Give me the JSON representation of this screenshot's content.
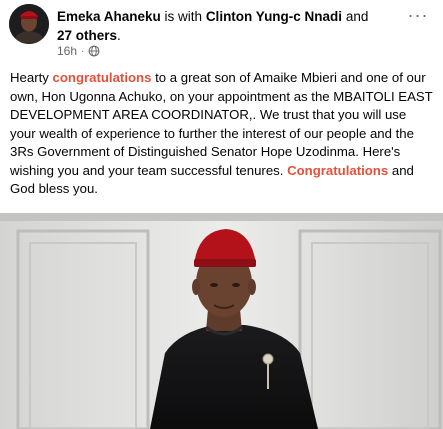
{
  "author": {
    "name": "Emeka Ahaneku",
    "with_text": " is with ",
    "tagged": "Clinton Yung-c Nnadi",
    "and_text": " and ",
    "others": "27 others",
    "period": "."
  },
  "meta": {
    "time": "16h",
    "separator": "·",
    "privacy_icon": "globe-icon"
  },
  "menu": {
    "label": "···"
  },
  "post": {
    "p1": "Hearty ",
    "h1": "congratulations",
    "p2": " to a great son of Amaike Mbieri  and one of our own, Hon Ugonna Achuko, on your appointment as the MBAITOLI EAST  DEVELOPMENT AREA COORDINATOR,. We trust that you will use your wealth of experience  to further the interest of our people and the 3Rs Government of Distinguished Senator Hope Uzodinma. Here's wishing you and your team  successful tenures. ",
    "h2": "Congratulations",
    "p3": " and God bless you."
  },
  "colors": {
    "accent": "#e4513b",
    "text": "#050505",
    "meta": "#65676b"
  }
}
